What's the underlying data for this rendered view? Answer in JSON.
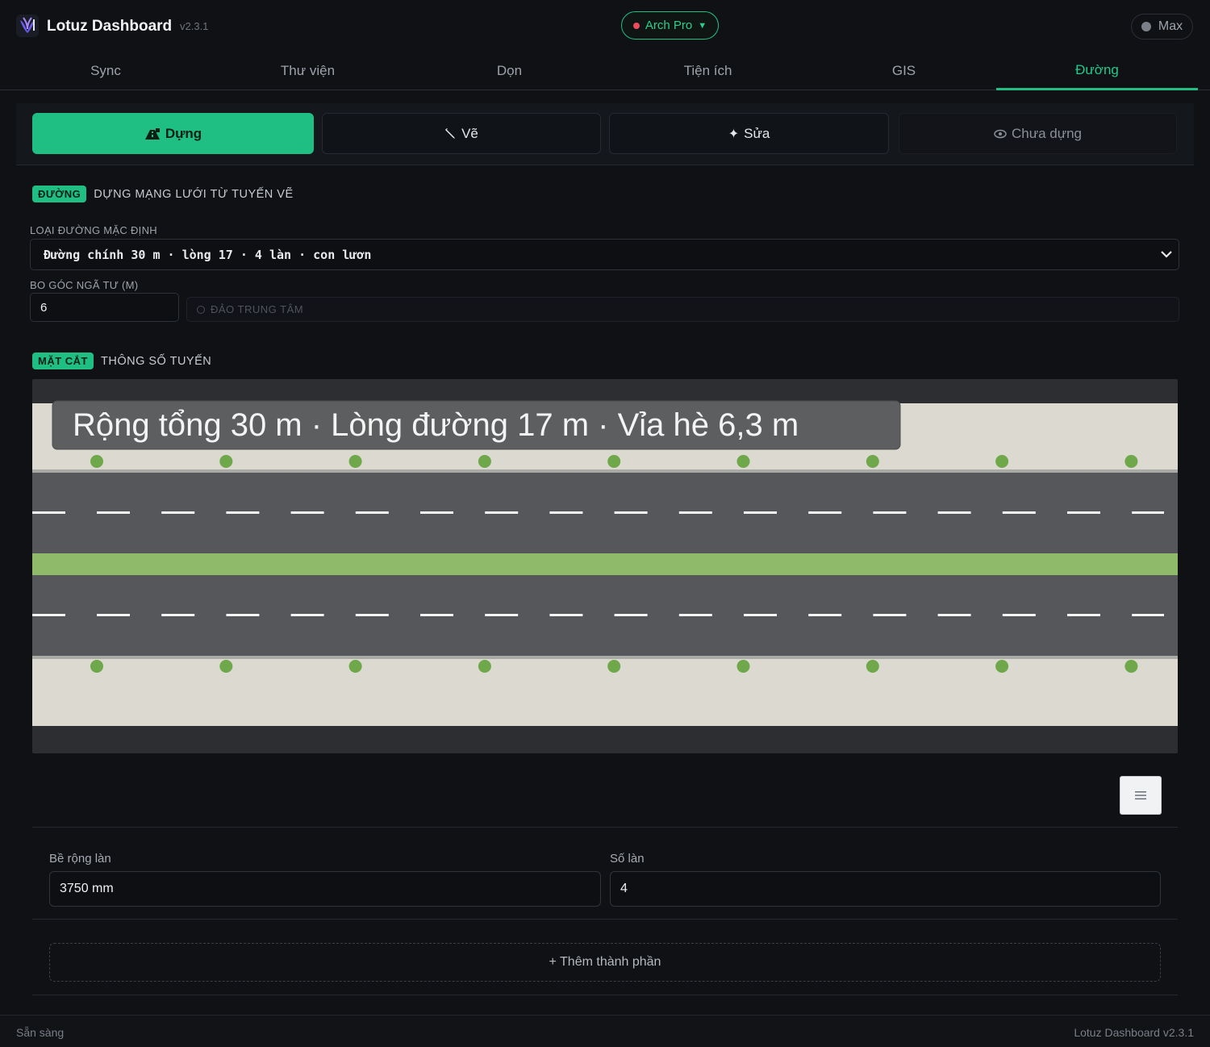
{
  "app": {
    "title": "Lotuz Dashboard",
    "version": "v2.3.1"
  },
  "profile": {
    "label": "Arch Pro",
    "status_color": "#ef4b5e"
  },
  "user": {
    "label": "Max"
  },
  "tabs": [
    {
      "label": "Sync",
      "active": false
    },
    {
      "label": "Thư viện",
      "active": false
    },
    {
      "label": "Dọn",
      "active": false
    },
    {
      "label": "Tiện ích",
      "active": false
    },
    {
      "label": "GIS",
      "active": false
    },
    {
      "label": "Đường",
      "active": true
    }
  ],
  "modes": [
    {
      "label": "Dựng",
      "icon": "road-build-icon",
      "state": "active"
    },
    {
      "label": "Vẽ",
      "icon": "pencil-icon",
      "state": "normal"
    },
    {
      "label": "Sửa",
      "icon": "sparkle-icon",
      "state": "normal"
    },
    {
      "label": "Chưa dựng",
      "icon": "eye-icon",
      "state": "muted"
    }
  ],
  "network_section": {
    "badge": "ĐƯỜNG",
    "title": "DỰNG MẠNG LƯỚI TỪ TUYẾN VẼ",
    "road_type_label": "LOẠI ĐƯỜNG MẶC ĐỊNH",
    "road_type_value": "Đường chính 30 m · lòng 17 · 4 làn · con lươn",
    "corner_label": "BO GÓC NGÃ TƯ (M)",
    "corner_value": "6",
    "roundabout_label": "ĐẢO TRUNG TÂM"
  },
  "profile_section": {
    "badge": "MẶT CẮT",
    "title": "THÔNG SỐ TUYẾN"
  },
  "cross_section": {
    "summary": "Rộng tổng 30 m · Lòng đường 17 m · Vỉa hè 6,3 m",
    "colors": {
      "sidewalk": "#dcd9d0",
      "road": "#55575b",
      "median": "#8fba6a",
      "tree": "#6ea84a",
      "marking": "#f5f5f5"
    },
    "tree_rows": 2,
    "trees_per_row": 9
  },
  "params": {
    "lane_width_label": "Bề rộng làn",
    "lane_width_value": "3750 mm",
    "lane_count_label": "Số làn",
    "lane_count_value": "4"
  },
  "add_component_label": "+ Thêm thành phần",
  "status": {
    "left": "Sẵn sàng",
    "right": "Lotuz Dashboard v2.3.1"
  }
}
